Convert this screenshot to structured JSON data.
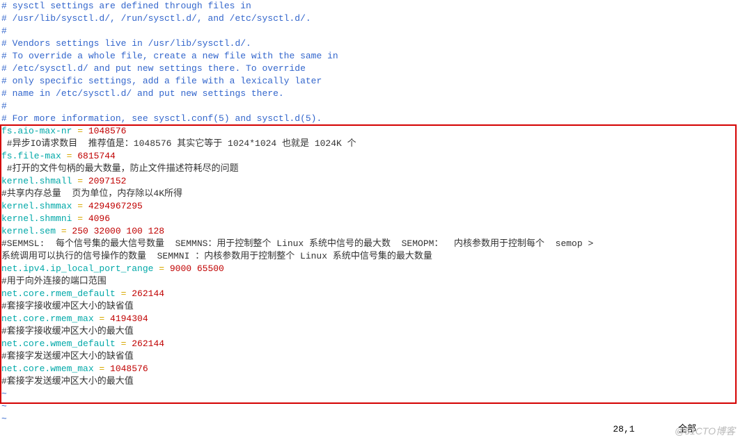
{
  "header_comments": [
    "# sysctl settings are defined through files in",
    "# /usr/lib/sysctl.d/, /run/sysctl.d/, and /etc/sysctl.d/.",
    "#",
    "# Vendors settings live in /usr/lib/sysctl.d/.",
    "# To override a whole file, create a new file with the same in",
    "# /etc/sysctl.d/ and put new settings there. To override",
    "# only specific settings, add a file with a lexically later",
    "# name in /etc/sysctl.d/ and put new settings there.",
    "#",
    "# For more information, see sysctl.conf(5) and sysctl.d(5)."
  ],
  "settings": {
    "s1": {
      "key": "fs.aio-max-nr",
      "eq": " = ",
      "val": "1048576"
    },
    "c1": " #异步IO请求数目  推荐值是：1048576 其实它等于 1024*1024 也就是 1024K 个",
    "s2": {
      "key": "fs.file-max",
      "eq": " = ",
      "val": "6815744"
    },
    "c2": " #打开的文件句柄的最大数量，防止文件描述符耗尽的问题",
    "s3": {
      "key": "kernel.shmall",
      "eq": " = ",
      "val": "2097152"
    },
    "c3": "#共享内存总量  页为单位，内存除以4K所得",
    "s4": {
      "key": "kernel.shmmax",
      "eq": " = ",
      "val": "4294967295"
    },
    "s5": {
      "key": "kernel.shmmni",
      "eq": " = ",
      "val": "4096"
    },
    "s6": {
      "key": "kernel.sem",
      "eq": " = ",
      "val": "250 32000 100 128"
    },
    "c6a": "#SEMMSL:  每个信号集的最大信号数量  SEMMNS：用于控制整个 Linux 系统中信号的最大数  SEMOPM：  内核参数用于控制每个  semop >",
    "c6b": "系统调用可以执行的信号操作的数量  SEMMNI ：内核参数用于控制整个 Linux 系统中信号集的最大数量",
    "s7": {
      "key": "net.ipv4.ip_local_port_range",
      "eq": " = ",
      "val": "9000 65500"
    },
    "c7": "#用于向外连接的端口范围",
    "s8": {
      "key": "net.core.rmem_default",
      "eq": " = ",
      "val": "262144"
    },
    "c8": "#套接字接收缓冲区大小的缺省值",
    "s9": {
      "key": "net.core.rmem_max",
      "eq": " = ",
      "val": "4194304"
    },
    "c9": "#套接字接收缓冲区大小的最大值",
    "s10": {
      "key": "net.core.wmem_default",
      "eq": " = ",
      "val": "262144"
    },
    "c10": "#套接字发送缓冲区大小的缺省值",
    "s11": {
      "key": "net.core.wmem_max",
      "eq": " = ",
      "val": "1048576"
    },
    "c11": "#套接字发送缓冲区大小的最大值"
  },
  "tilde": "~",
  "status": {
    "pos": "28,1",
    "mode": "全部"
  },
  "watermark": "@51CTO博客"
}
